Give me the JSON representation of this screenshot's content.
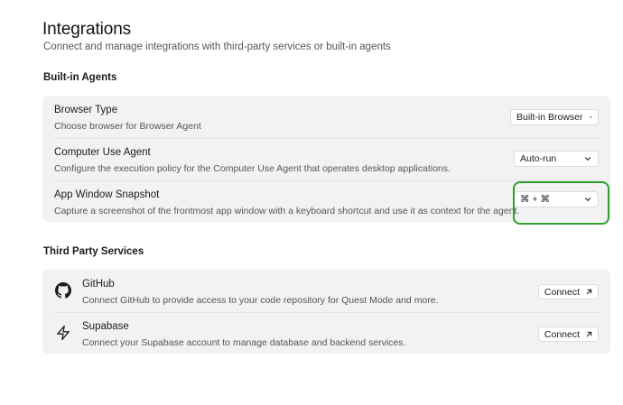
{
  "header": {
    "title": "Integrations",
    "subtitle": "Connect and manage integrations with third-party services or built-in agents"
  },
  "built_in_agents": {
    "section_title": "Built-in Agents",
    "rows": [
      {
        "title": "Browser Type",
        "description": "Choose browser for Browser Agent",
        "select_value": "Built-in Browser"
      },
      {
        "title": "Computer Use Agent",
        "description": "Configure the execution policy for the Computer Use Agent that operates desktop applications.",
        "select_value": "Auto-run"
      },
      {
        "title": "App Window Snapshot",
        "description": "Capture a screenshot of the frontmost app window with a keyboard shortcut and use it as context for the agent.",
        "select_value": "⌘ + ⌘"
      }
    ]
  },
  "third_party": {
    "section_title": "Third Party Services",
    "services": [
      {
        "name": "GitHub",
        "description": "Connect GitHub to provide access to your code repository for Quest Mode and more.",
        "button_label": "Connect",
        "icon": "github-icon"
      },
      {
        "name": "Supabase",
        "description": "Connect your Supabase account to manage database and backend services.",
        "button_label": "Connect",
        "icon": "supabase-icon"
      }
    ]
  },
  "colors": {
    "highlight": "#2aa02a",
    "card_bg": "#f2f2f3"
  }
}
